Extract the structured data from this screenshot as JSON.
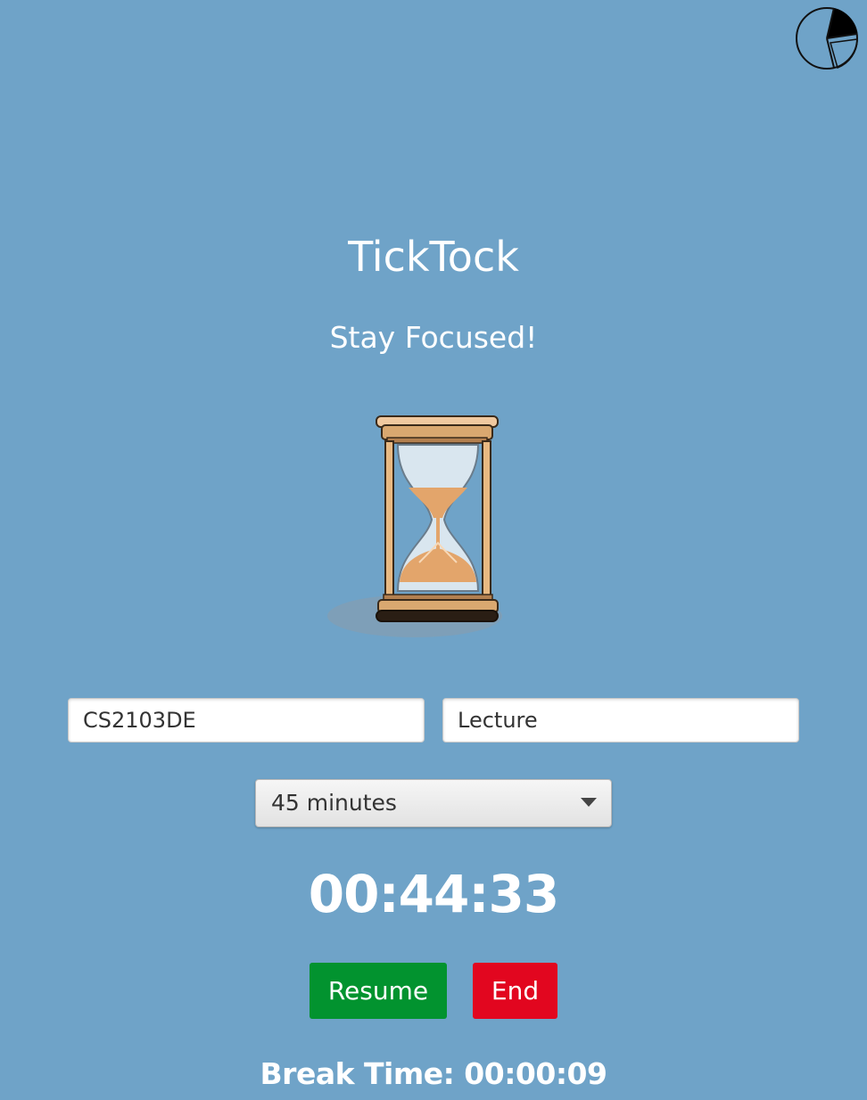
{
  "header": {
    "stats_icon": "pie-chart-icon"
  },
  "app": {
    "title": "TickTock",
    "subtitle": "Stay Focused!",
    "illustration": "hourglass-icon"
  },
  "form": {
    "module_code": "CS2103DE",
    "session_type": "Lecture",
    "duration": {
      "selected": "45 minutes"
    }
  },
  "timer": {
    "remaining": "00:44:33"
  },
  "controls": {
    "resume_label": "Resume",
    "end_label": "End",
    "resume_color": "#02932f",
    "end_color": "#e2061f"
  },
  "break": {
    "text": "Break Time: 00:00:09"
  },
  "colors": {
    "background": "#6fa3c8",
    "text": "#ffffff"
  }
}
